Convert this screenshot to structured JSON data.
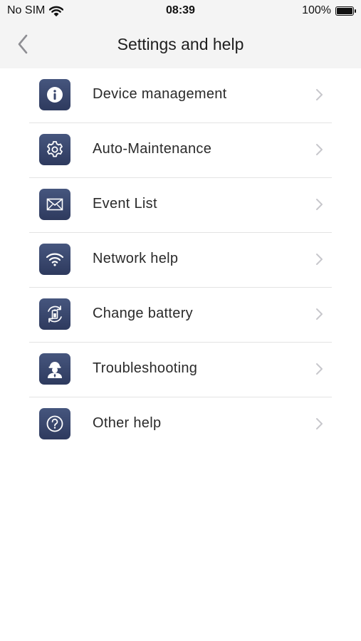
{
  "status_bar": {
    "carrier": "No SIM",
    "time": "08:39",
    "battery_percent": "100%",
    "battery_level": 1.0
  },
  "nav": {
    "title": "Settings and help",
    "back_icon": "chevron-left-icon"
  },
  "menu": {
    "items": [
      {
        "label": "Device management",
        "icon": "info-icon"
      },
      {
        "label": "Auto-Maintenance",
        "icon": "gear-icon"
      },
      {
        "label": "Event List",
        "icon": "envelope-icon"
      },
      {
        "label": "Network help",
        "icon": "wifi-icon"
      },
      {
        "label": "Change battery",
        "icon": "battery-swap-icon"
      },
      {
        "label": "Troubleshooting",
        "icon": "technician-icon"
      },
      {
        "label": "Other help",
        "icon": "question-icon"
      }
    ]
  },
  "colors": {
    "icon_bg": "#3a476d",
    "header_bg": "#f4f4f4",
    "divider": "#e3e3e3",
    "chevron": "#c7c7cc"
  }
}
